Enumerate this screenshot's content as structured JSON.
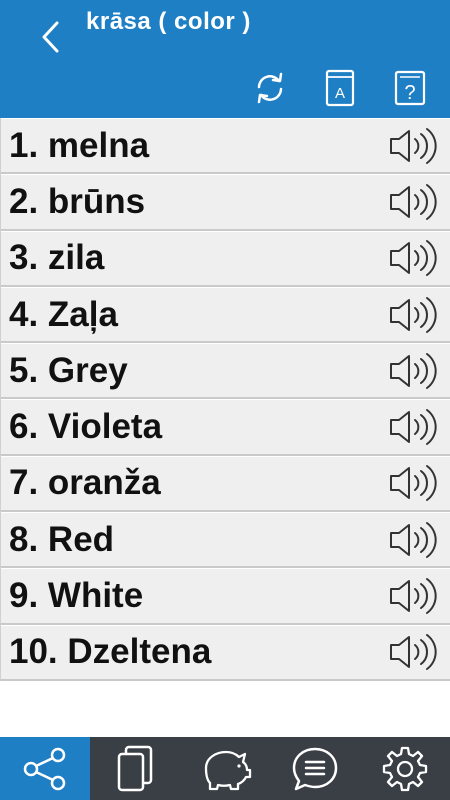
{
  "header": {
    "title": "krāsa ( color )",
    "back_icon": "chevron-left-icon",
    "tools": [
      {
        "name": "refresh",
        "icon": "refresh-icon"
      },
      {
        "name": "dictionary",
        "icon": "dictionary-book-icon",
        "glyph": "A"
      },
      {
        "name": "help",
        "icon": "help-icon",
        "glyph": "?"
      }
    ]
  },
  "words": [
    {
      "label": "1. melna"
    },
    {
      "label": "2. brūns"
    },
    {
      "label": "3. zila"
    },
    {
      "label": "4. Zaļa"
    },
    {
      "label": "5. Grey"
    },
    {
      "label": "6. Violeta"
    },
    {
      "label": "7. oranža"
    },
    {
      "label": "8. Red"
    },
    {
      "label": "9. White"
    },
    {
      "label": "10. Dzeltena"
    }
  ],
  "bottom_nav": [
    {
      "name": "share",
      "icon": "share-icon",
      "active": true
    },
    {
      "name": "cards",
      "icon": "cards-icon",
      "active": false
    },
    {
      "name": "piggy-bank",
      "icon": "piggy-bank-icon",
      "active": false
    },
    {
      "name": "chat",
      "icon": "chat-icon",
      "active": false
    },
    {
      "name": "settings",
      "icon": "gear-icon",
      "active": false
    }
  ],
  "colors": {
    "header_bg": "#1f7fc5",
    "row_bg": "#efefef",
    "bottom_bar_bg": "#3a3f46",
    "active_nav_bg": "#1f7fc5"
  }
}
